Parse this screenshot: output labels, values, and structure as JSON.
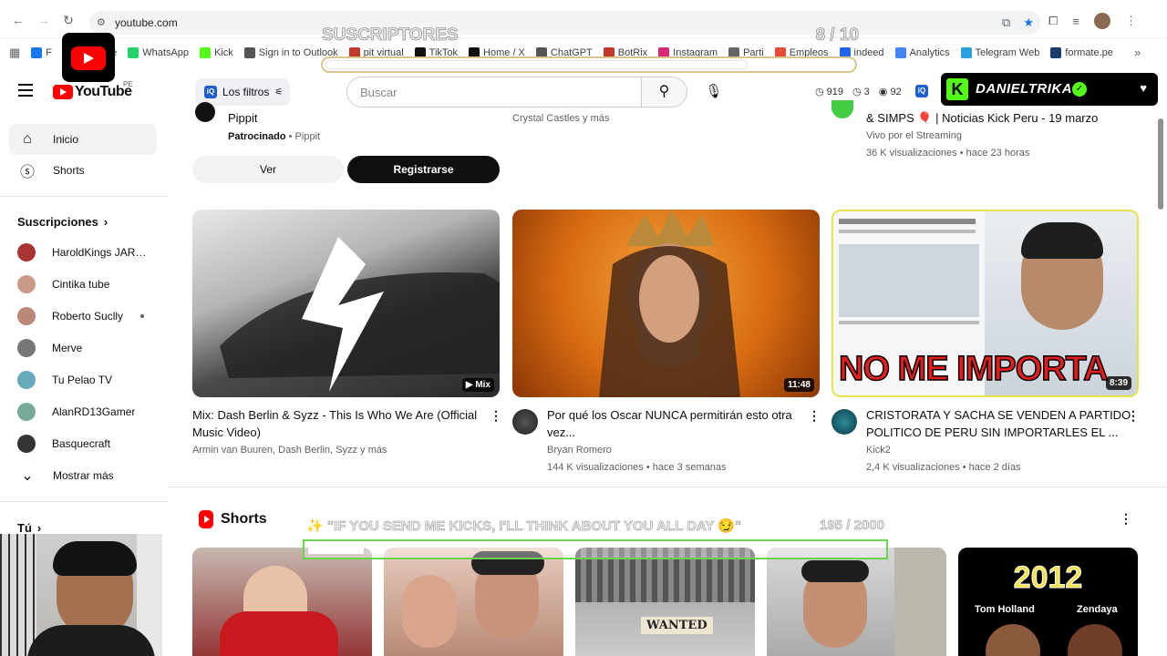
{
  "browser": {
    "url": "youtube.com",
    "bookmarks": [
      {
        "label": "F",
        "color": "#1877f2"
      },
      {
        "label": "YouTube",
        "color": "#ff0000"
      },
      {
        "label": "WhatsApp",
        "color": "#25d366"
      },
      {
        "label": "Kick",
        "color": "#53fc18"
      },
      {
        "label": "Sign in to Outlook",
        "color": "#555555"
      },
      {
        "label": "pit virtual",
        "color": "#c0392b"
      },
      {
        "label": "TikTok",
        "color": "#111111"
      },
      {
        "label": "Home / X",
        "color": "#111111"
      },
      {
        "label": "ChatGPT",
        "color": "#555555"
      },
      {
        "label": "BotRix",
        "color": "#c0392b"
      },
      {
        "label": "Instagram",
        "color": "#d62976"
      },
      {
        "label": "Parti",
        "color": "#666666"
      },
      {
        "label": "Empleos",
        "color": "#e74c3c"
      },
      {
        "label": "indeed",
        "color": "#2164f3"
      },
      {
        "label": "Analytics",
        "color": "#4285f4"
      },
      {
        "label": "Telegram Web",
        "color": "#2aa1de"
      },
      {
        "label": "formate.pe",
        "color": "#1a3d6d"
      }
    ]
  },
  "header": {
    "logo_text": "YouTube",
    "country": "PE",
    "filters_label": "Los filtros",
    "iq_badge": "iQ",
    "search_placeholder": "Buscar",
    "stats": [
      "919",
      "3",
      "92"
    ]
  },
  "overlays": {
    "subs_title": "SUSCRIPTORES",
    "subs_count": "8 / 10",
    "subs_progress": 0.8,
    "kick_name": "DANIELTRIKA",
    "kick_badge_letter": "K",
    "goal_title": "✨ \"IF YOU SEND ME KICKS, I'LL THINK ABOUT YOU ALL DAY 😏\"",
    "goal_count": "195 / 2000",
    "goal_progress": 0.0975
  },
  "sidebar": {
    "inicio": "Inicio",
    "shorts": "Shorts",
    "subs_heading": "Suscripciones",
    "subscriptions": [
      {
        "name": "HaroldKings JARA...",
        "color": "#a33"
      },
      {
        "name": "Cintika tube",
        "color": "#c98"
      },
      {
        "name": "Roberto Suclly",
        "color": "#b87"
      },
      {
        "name": "Merve",
        "color": "#777"
      },
      {
        "name": "Tu Pelao TV",
        "color": "#6ab"
      },
      {
        "name": "AlanRD13Gamer",
        "color": "#7a9"
      },
      {
        "name": "Basquecraft",
        "color": "#333"
      }
    ],
    "show_more": "Mostrar más",
    "tu_heading": "Tú"
  },
  "ad": {
    "title": "Pippit",
    "sponsored": "Patrocinado",
    "brand": "Pippit",
    "ver": "Ver",
    "register": "Registrarse"
  },
  "top_row": {
    "mid_meta": "Crystal Castles y más",
    "right_title": "& SIMPS 🎈 | Noticias Kick Peru - 19 marzo",
    "right_meta1": "Vivo por el Streaming",
    "right_meta2": "36 K visualizaciones • hace 23 horas"
  },
  "videos": [
    {
      "title1": "Mix: Dash Berlin & Syzz - This Is Who We Are (Official",
      "title2": "Music Video)",
      "meta1": "Armin van Buuren, Dash Berlin, Syzz y más",
      "meta2": "",
      "badge": "Mix"
    },
    {
      "title1": "Por qué los Oscar NUNCA permitirán esto otra",
      "title2": "vez...",
      "meta1": "Bryan Romero",
      "meta2": "144 K visualizaciones • hace 3 semanas",
      "badge": "11:48"
    },
    {
      "title1": "CRISTORATA Y SACHA SE VENDEN A PARTIDO",
      "title2": "POLITICO DE PERU SIN IMPORTARLES EL ...",
      "meta1": "Kick2",
      "meta2": "2,4 K visualizaciones • hace 2 días",
      "badge": "8:39",
      "thumb_text": "NO ME IMPORTA"
    }
  ],
  "shorts": {
    "heading": "Shorts",
    "items": [
      {
        "label": ""
      },
      {
        "label": ""
      },
      {
        "label": "WANTED"
      },
      {
        "label": ""
      },
      {
        "label": "2012",
        "sub_left": "Tom Holland",
        "sub_right": "Zendaya"
      }
    ]
  }
}
